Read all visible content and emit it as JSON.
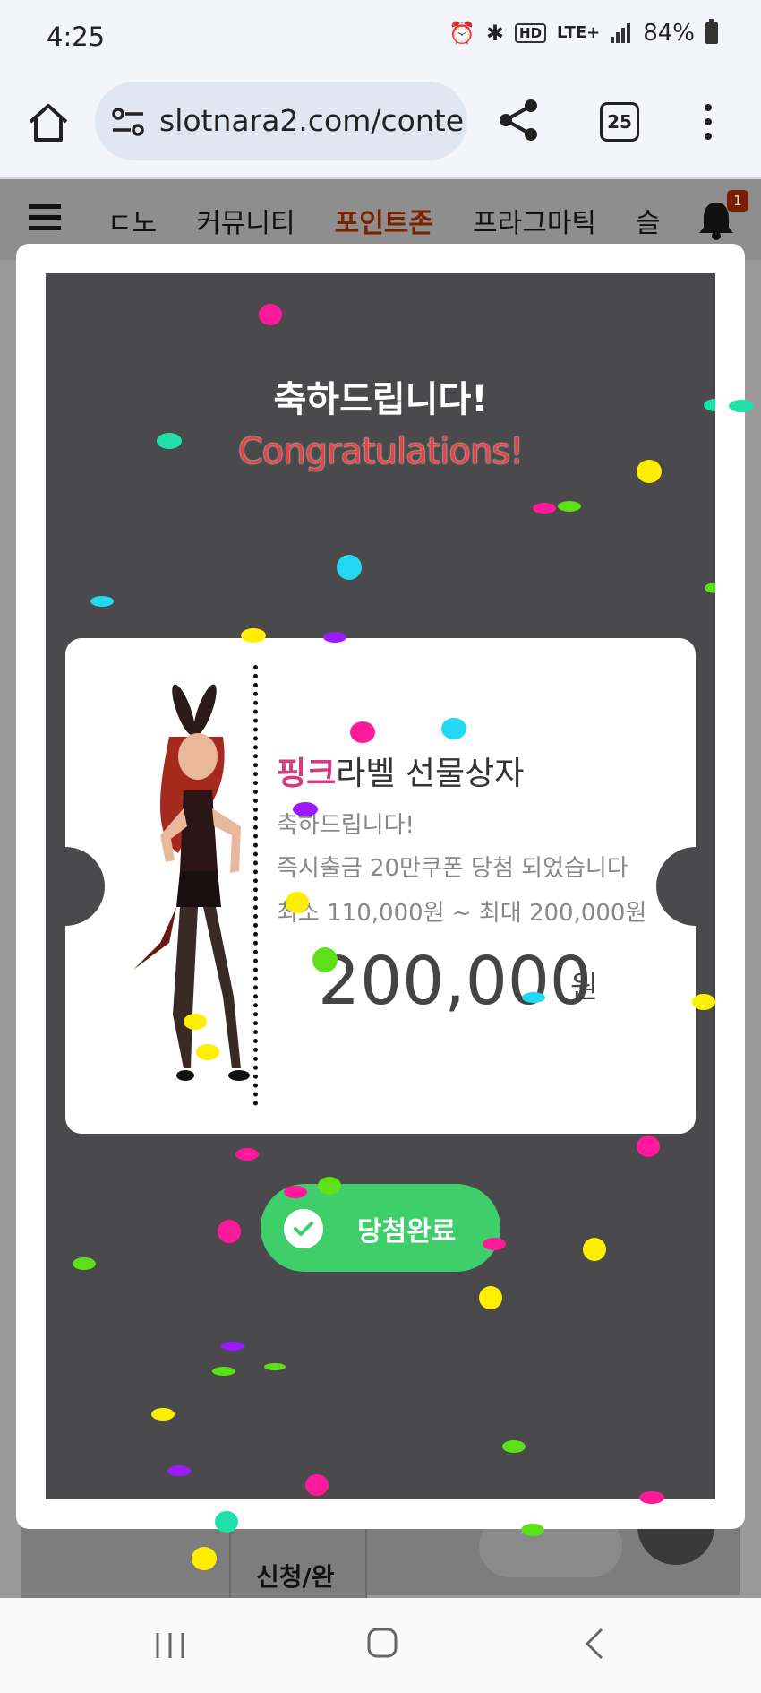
{
  "status_bar": {
    "time": "4:25",
    "network": "LTE+",
    "hd": "HD",
    "battery": "84%"
  },
  "browser": {
    "url": "slotnara2.com/conte",
    "tab_count": "25"
  },
  "site_nav": {
    "items": [
      "ㄷ노",
      "커뮤니티",
      "포인트존",
      "프라그마틱",
      "슬"
    ],
    "active_index": 2,
    "notification_count": "1"
  },
  "background_page": {
    "cell_label": "신청/완"
  },
  "modal": {
    "title_ko": "축하드립니다!",
    "title_en": "Congratulations!",
    "prize_name_highlight": "핑크",
    "prize_name_rest": "라벨 선물상자",
    "congrats": "축하드립니다!",
    "description": "즉시출금 20만쿠폰 당첨 되었습니다",
    "range": "최소 110,000원 ~ 최대 200,000원",
    "amount": "200,000",
    "unit": "원",
    "done_button": "당첨완료"
  },
  "colors": {
    "accent_pink": "#d63a82",
    "congrats_red": "#e84344",
    "done_green": "#3ecf6a",
    "modal_bg": "#4a494b"
  }
}
